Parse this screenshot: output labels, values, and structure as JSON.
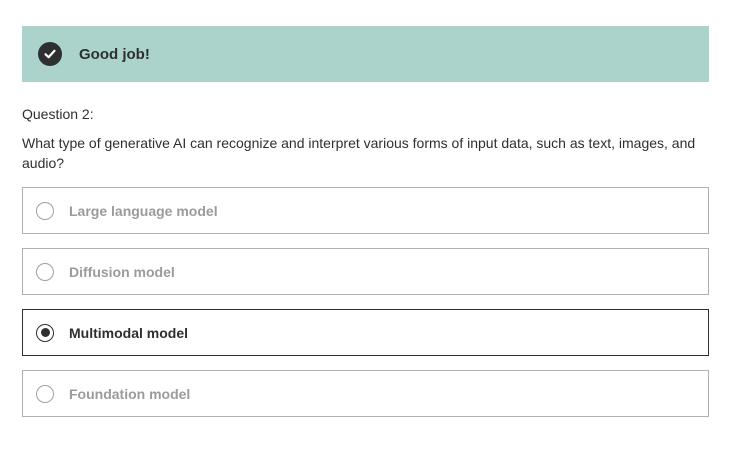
{
  "feedback": {
    "icon": "check-circle-icon",
    "message": "Good job!",
    "background_color": "#acd2cc"
  },
  "question": {
    "label": "Question 2:",
    "text": "What type of generative AI can recognize and interpret various forms of input data, such as text, images, and audio?"
  },
  "options": [
    {
      "label": "Large language model",
      "selected": false
    },
    {
      "label": "Diffusion model",
      "selected": false
    },
    {
      "label": "Multimodal model",
      "selected": true
    },
    {
      "label": "Foundation model",
      "selected": false
    }
  ]
}
